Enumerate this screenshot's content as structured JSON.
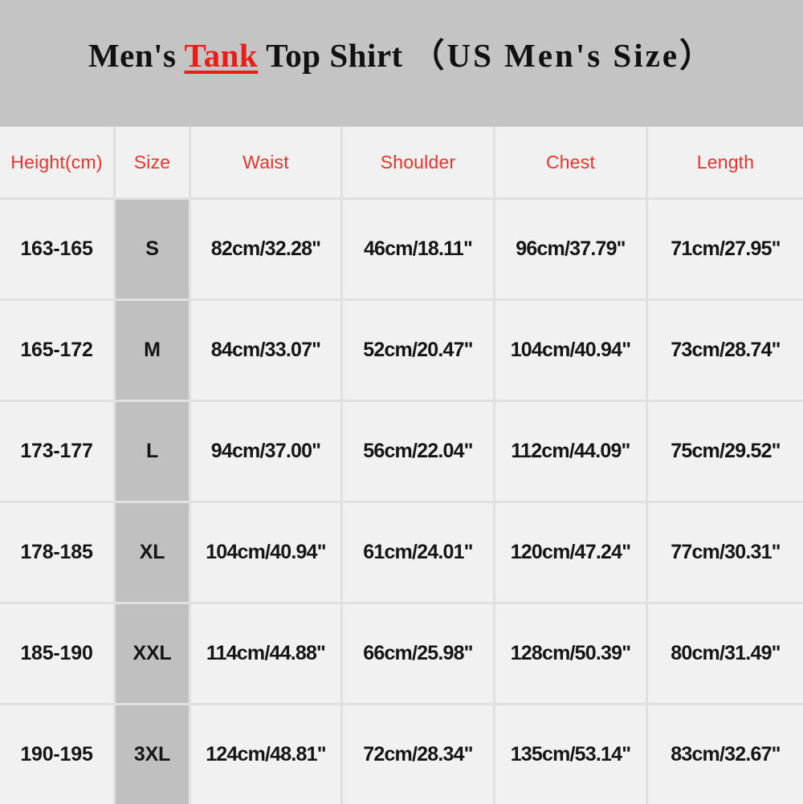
{
  "title": {
    "prefix": "Men's ",
    "highlight": "Tank",
    "middle": " Top Shirt ",
    "suffix": "（US  Men's  Size）",
    "highlight_color": "#ea1d17",
    "band_color": "#c4c4c4"
  },
  "table": {
    "header_color": "#ee3229",
    "size_column_color": "#c0c0c0",
    "cell_color": "#f1f1f1",
    "columns": [
      "Height(cm)",
      "Size",
      "Waist",
      "Shoulder",
      "Chest",
      "Length"
    ],
    "rows": [
      {
        "height": "163-165",
        "size": "S",
        "waist": "82cm/32.28\"",
        "shoulder": "46cm/18.11\"",
        "chest": "96cm/37.79\"",
        "length": "71cm/27.95\""
      },
      {
        "height": "165-172",
        "size": "M",
        "waist": "84cm/33.07\"",
        "shoulder": "52cm/20.47\"",
        "chest": "104cm/40.94\"",
        "length": "73cm/28.74\""
      },
      {
        "height": "173-177",
        "size": "L",
        "waist": "94cm/37.00\"",
        "shoulder": "56cm/22.04\"",
        "chest": "112cm/44.09\"",
        "length": "75cm/29.52\""
      },
      {
        "height": "178-185",
        "size": "XL",
        "waist": "104cm/40.94\"",
        "shoulder": "61cm/24.01\"",
        "chest": "120cm/47.24\"",
        "length": "77cm/30.31\""
      },
      {
        "height": "185-190",
        "size": "XXL",
        "waist": "114cm/44.88\"",
        "shoulder": "66cm/25.98\"",
        "chest": "128cm/50.39\"",
        "length": "80cm/31.49\""
      },
      {
        "height": "190-195",
        "size": "3XL",
        "waist": "124cm/48.81\"",
        "shoulder": "72cm/28.34\"",
        "chest": "135cm/53.14\"",
        "length": "83cm/32.67\""
      }
    ]
  },
  "chart_data": {
    "type": "table",
    "title": "Men's Tank Top Shirt （US Men's Size）",
    "columns": [
      "Height(cm)",
      "Size",
      "Waist",
      "Shoulder",
      "Chest",
      "Length"
    ],
    "rows": [
      [
        "163-165",
        "S",
        "82cm/32.28\"",
        "46cm/18.11\"",
        "96cm/37.79\"",
        "71cm/27.95\""
      ],
      [
        "165-172",
        "M",
        "84cm/33.07\"",
        "52cm/20.47\"",
        "104cm/40.94\"",
        "73cm/28.74\""
      ],
      [
        "173-177",
        "L",
        "94cm/37.00\"",
        "56cm/22.04\"",
        "112cm/44.09\"",
        "75cm/29.52\""
      ],
      [
        "178-185",
        "XL",
        "104cm/40.94\"",
        "61cm/24.01\"",
        "120cm/47.24\"",
        "77cm/30.31\""
      ],
      [
        "185-190",
        "XXL",
        "114cm/44.88\"",
        "66cm/25.98\"",
        "128cm/50.39\"",
        "80cm/31.49\""
      ],
      [
        "190-195",
        "3XL",
        "124cm/48.81\"",
        "72cm/28.34\"",
        "135cm/53.14\"",
        "83cm/32.67\""
      ]
    ]
  }
}
